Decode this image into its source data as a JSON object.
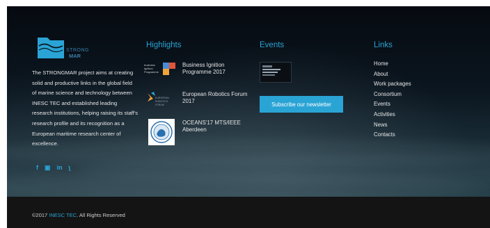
{
  "about": {
    "logo_line1": "STRONG",
    "logo_line2": "MAR",
    "text": "The STRONGMAR project aims at creating solid and productive links in the global field of marine science and technology between INESC TEC and established leading research institutions, helping raising its staff's research profile and its recognition as a European maritime research center of excellence.",
    "social": [
      {
        "icon": "facebook-icon",
        "glyph": "f"
      },
      {
        "icon": "youtube-icon",
        "glyph": "▣"
      },
      {
        "icon": "linkedin-icon",
        "glyph": "in"
      },
      {
        "icon": "rss-icon",
        "glyph": "ʅ"
      }
    ]
  },
  "highlights": {
    "title": "Highlights",
    "items": [
      {
        "label": "Business Ignition Programme 2017",
        "logo_text": "business ignition programme"
      },
      {
        "label": "European Robotics Forum 2017",
        "logo_text": "EUROPEAN ROBOTICS FORUM"
      },
      {
        "label": "OCEANS'17 MTS/IEEE Aberdeen",
        "logo_text": ""
      }
    ]
  },
  "events": {
    "title": "Events",
    "newsletter_label": "Subscribe our newsletter"
  },
  "links": {
    "title": "Links",
    "items": [
      "Home",
      "About",
      "Work packages",
      "Consortium",
      "Events",
      "Activities",
      "News",
      "Contacts"
    ]
  },
  "footer": {
    "copyright_prefix": "©2017 ",
    "copyright_link": "INESC TEC",
    "copyright_suffix": ". All Rights Reserved"
  },
  "colors": {
    "accent": "#2aa4d5",
    "bottom_bar": "#141414"
  }
}
